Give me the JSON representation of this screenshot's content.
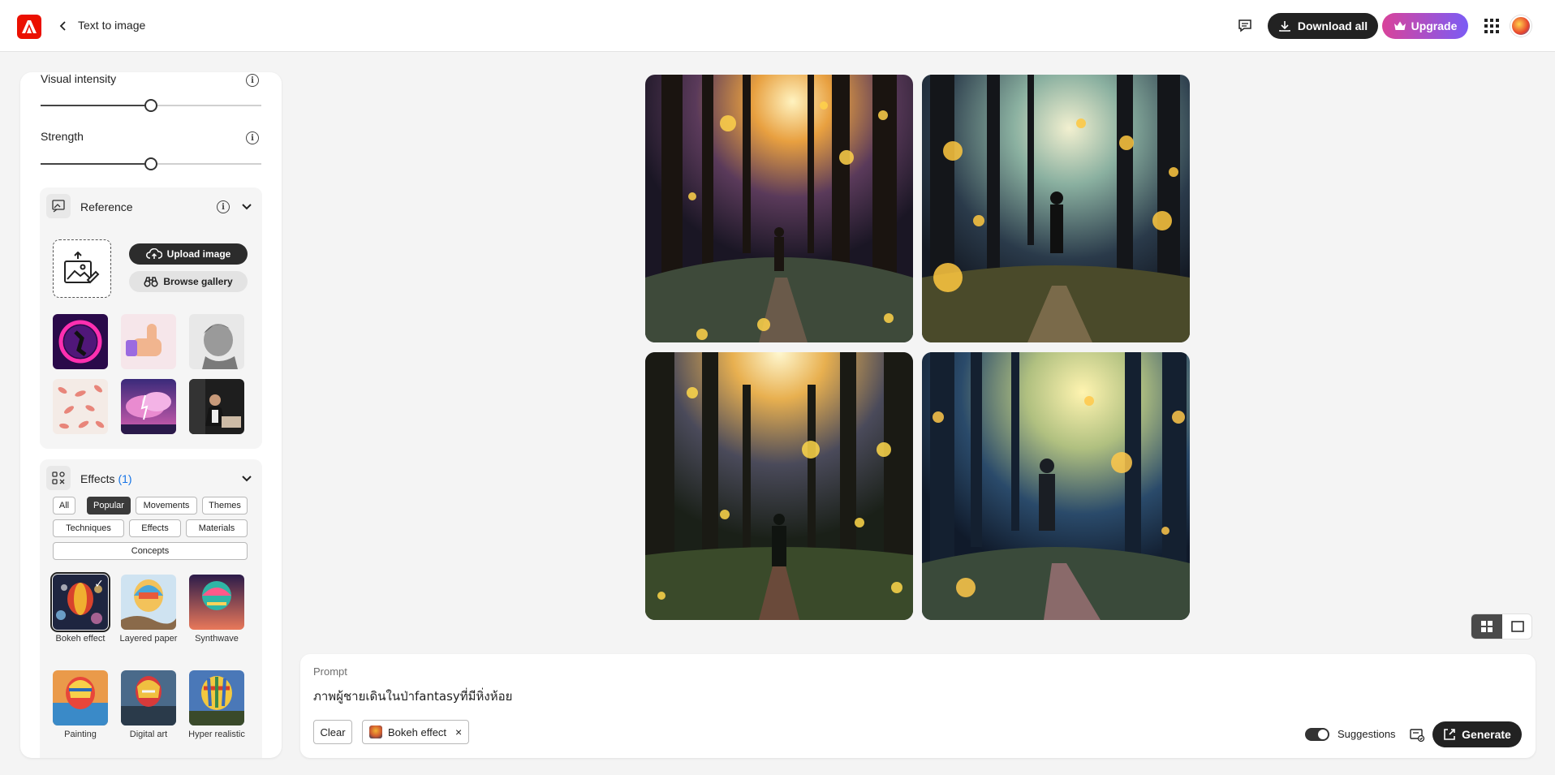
{
  "header": {
    "breadcrumb": "Text to image",
    "download_all": "Download all",
    "upgrade": "Upgrade"
  },
  "panel": {
    "visual_intensity": {
      "label": "Visual intensity",
      "level": 0.5
    },
    "strength": {
      "label": "Strength",
      "level": 0.5
    },
    "reference": {
      "title": "Reference",
      "upload_image": "Upload image",
      "browse_gallery": "Browse gallery"
    },
    "effects": {
      "title": "Effects",
      "count": "(1)",
      "filters": [
        "All",
        "Popular",
        "Movements",
        "Themes",
        "Techniques",
        "Effects",
        "Materials",
        "Concepts"
      ],
      "active_filter": "Popular",
      "items": [
        {
          "label": "Bokeh effect",
          "selected": true
        },
        {
          "label": "Layered paper",
          "selected": false
        },
        {
          "label": "Synthwave",
          "selected": false
        },
        {
          "label": "Painting",
          "selected": false
        },
        {
          "label": "Digital art",
          "selected": false
        },
        {
          "label": "Hyper realistic",
          "selected": false
        }
      ]
    }
  },
  "prompt": {
    "label": "Prompt",
    "text": "ภาพผู้ชายเดินในป่าfantasyที่มีหิ่งห้อย",
    "clear": "Clear",
    "tag": "Bokeh effect",
    "tag_close": "×",
    "suggestions": "Suggestions",
    "generate": "Generate"
  },
  "colors": {
    "accent": "#eb1000",
    "dark": "#222222",
    "link": "#1473e6"
  }
}
